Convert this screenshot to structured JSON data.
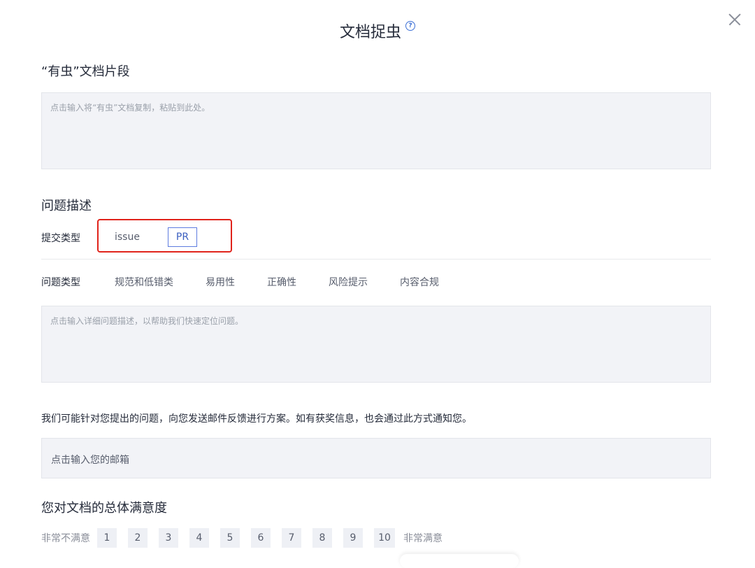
{
  "dialog": {
    "title": "文档捉虫",
    "help_icon": "question-circle-icon",
    "close_icon": "close-icon"
  },
  "snippet": {
    "heading": "“有虫”文档片段",
    "placeholder": "点击输入将“有虫”文档复制，粘贴到此处。"
  },
  "problem": {
    "heading": "问题描述",
    "submit_type_label": "提交类型",
    "submit_types": [
      "issue",
      "PR"
    ],
    "selected_submit_type": "PR",
    "problem_type_label": "问题类型",
    "categories": [
      "规范和低错类",
      "易用性",
      "正确性",
      "风险提示",
      "内容合规"
    ],
    "description_placeholder": "点击输入详细问题描述，以帮助我们快速定位问题。"
  },
  "contact": {
    "notice": "我们可能针对您提出的问题，向您发送邮件反馈进行方案。如有获奖信息，也会通过此方式通知您。",
    "email_placeholder": "点击输入您的邮箱"
  },
  "satisfaction": {
    "heading": "您对文档的总体满意度",
    "low_label": "非常不满意",
    "high_label": "非常满意",
    "scores": [
      "1",
      "2",
      "3",
      "4",
      "5",
      "6",
      "7",
      "8",
      "9",
      "10"
    ]
  },
  "colors": {
    "highlight_border": "#e0231b",
    "accent": "#5e7ce0",
    "input_bg": "#f2f3f7"
  }
}
